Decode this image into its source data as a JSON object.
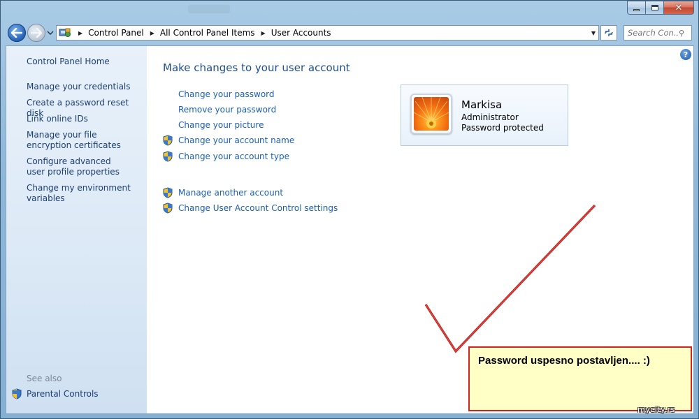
{
  "address_bar": {
    "crumbs": [
      "Control Panel",
      "All Control Panel Items",
      "User Accounts"
    ]
  },
  "search": {
    "placeholder": "Search Con..."
  },
  "sidebar": {
    "home": "Control Panel Home",
    "links": [
      "Manage your credentials",
      "Create a password reset disk",
      "Link online IDs",
      "Manage your file encryption certificates",
      "Configure advanced user profile properties",
      "Change my environment variables"
    ],
    "see_also": "See also",
    "see_also_links": [
      "Parental Controls"
    ]
  },
  "main": {
    "heading": "Make changes to your user account",
    "tasks": [
      "Change your password",
      "Remove your password",
      "Change your picture",
      "Change your account name",
      "Change your account type"
    ],
    "other_tasks": [
      "Manage another account",
      "Change User Account Control settings"
    ]
  },
  "account": {
    "name": "Markisa",
    "type": "Administrator",
    "status": "Password protected"
  },
  "annotation": {
    "text": "Password uspesno postavljen.... :)",
    "watermark": "mycity.rs",
    "color": "#d4221e"
  },
  "colors": {
    "link": "#1a5fb4",
    "heading": "#1e4e8c",
    "sidebar_link": "#1c3f72"
  }
}
